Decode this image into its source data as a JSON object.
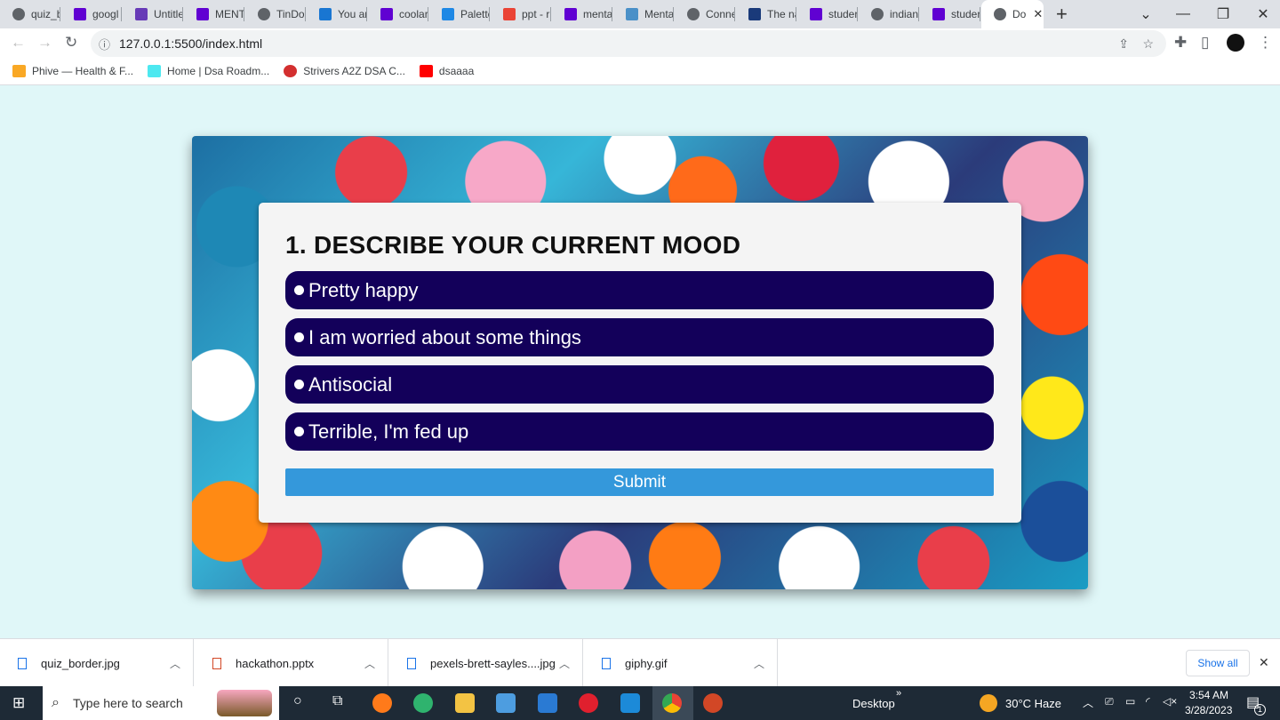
{
  "browser": {
    "tabs": [
      {
        "title": "quiz_b",
        "icon": "globe-icon",
        "color": "#5f6368"
      },
      {
        "title": "googl",
        "icon": "yahoo-icon",
        "color": "#6001d2"
      },
      {
        "title": "Untitle",
        "icon": "forms-icon",
        "color": "#673ab7"
      },
      {
        "title": "MENT",
        "icon": "yahoo-icon",
        "color": "#6001d2"
      },
      {
        "title": "TinDo",
        "icon": "globe-icon",
        "color": "#5f6368"
      },
      {
        "title": "You ar",
        "icon": "s-icon",
        "color": "#1976d2"
      },
      {
        "title": "coolar",
        "icon": "yahoo-icon",
        "color": "#6001d2"
      },
      {
        "title": "Palette",
        "icon": "c-icon",
        "color": "#1e88e5"
      },
      {
        "title": "ppt - r",
        "icon": "gmail-icon",
        "color": "#ea4335"
      },
      {
        "title": "menta",
        "icon": "yahoo-icon",
        "color": "#6001d2"
      },
      {
        "title": "Menta",
        "icon": "who-icon",
        "color": "#4a90c8"
      },
      {
        "title": "Conne",
        "icon": "globe-icon",
        "color": "#5f6368"
      },
      {
        "title": "The na",
        "icon": "l-icon",
        "color": "#1a3a7a"
      },
      {
        "title": "studer",
        "icon": "yahoo-icon",
        "color": "#6001d2"
      },
      {
        "title": "indian",
        "icon": "globe-icon",
        "color": "#5f6368"
      },
      {
        "title": "studer",
        "icon": "yahoo-icon",
        "color": "#6001d2"
      },
      {
        "title": "Do",
        "icon": "globe-icon",
        "color": "#5f6368",
        "active": true
      }
    ],
    "url": "127.0.0.1:5500/index.html",
    "bookmarks": [
      {
        "label": "Phive — Health & F...",
        "icon": "phive-icon",
        "color": "#f9a825"
      },
      {
        "label": "Home | Dsa Roadm...",
        "icon": "tm-icon",
        "color": "#4de8f0"
      },
      {
        "label": "Strivers A2Z DSA C...",
        "icon": "tuf-icon",
        "color": "#d32f2f"
      },
      {
        "label": "dsaaaa",
        "icon": "youtube-icon",
        "color": "#ff0000"
      }
    ]
  },
  "quiz": {
    "question": "1. DESCRIBE YOUR CURRENT MOOD",
    "options": [
      "Pretty happy",
      "I am worried about some things",
      "Antisocial",
      "Terrible, I'm fed up"
    ],
    "submit": "Submit",
    "option_color": "#13005a",
    "submit_color": "#3498db"
  },
  "downloads": {
    "items": [
      "quiz_border.jpg",
      "hackathon.pptx",
      "pexels-brett-sayles....jpg",
      "giphy.gif"
    ],
    "show_all": "Show all"
  },
  "taskbar": {
    "search_placeholder": "Type here to search",
    "desktop": "Desktop",
    "weather": "30°C  Haze",
    "time": "3:54 AM",
    "date": "3/28/2023",
    "notifications": "1"
  }
}
